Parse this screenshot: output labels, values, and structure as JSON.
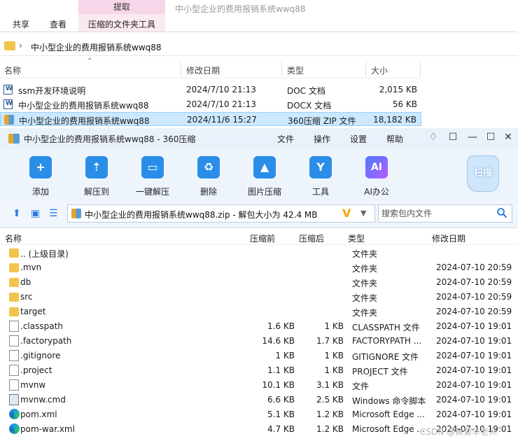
{
  "explorer": {
    "ribbon_tabs": [
      "共享",
      "查看"
    ],
    "context_tab_head": "提取",
    "context_tab": "压缩的文件夹工具",
    "ghost_title": "中小型企业的费用报销系统wwq88",
    "address": "中小型企业的费用报销系统wwq88",
    "columns": [
      "名称",
      "修改日期",
      "类型",
      "大小"
    ],
    "rows": [
      {
        "name": "ssm开发环境说明",
        "date": "2024/7/10 21:13",
        "type": "DOC 文档",
        "size": "2,015 KB",
        "icon": "word-icon"
      },
      {
        "name": "中小型企业的费用报销系统wwq88",
        "date": "2024/7/10 21:13",
        "type": "DOCX 文档",
        "size": "56 KB",
        "icon": "word-icon"
      },
      {
        "name": "中小型企业的费用报销系统wwq88",
        "date": "2024/11/6 15:27",
        "type": "360压缩 ZIP 文件",
        "size": "18,182 KB",
        "icon": "zip-icon",
        "selected": true
      }
    ]
  },
  "zipwin": {
    "title": "中小型企业的费用报销系统wwq88 - 360压缩",
    "menu": [
      "文件",
      "操作",
      "设置",
      "帮助"
    ],
    "tools": [
      {
        "label": "添加",
        "glyph": "+"
      },
      {
        "label": "解压到",
        "glyph": "⇡"
      },
      {
        "label": "一键解压",
        "glyph": "▭"
      },
      {
        "label": "删除",
        "glyph": "♻"
      },
      {
        "label": "图片压缩",
        "glyph": "▲"
      },
      {
        "label": "工具",
        "glyph": "Y"
      },
      {
        "label": "AI办公",
        "glyph": "AI"
      }
    ],
    "scan_label": "扫描",
    "path": "中小型企业的费用报销系统wwq88.zip - 解包大小为 42.4 MB",
    "search_placeholder": "搜索包内文件",
    "columns": [
      "名称",
      "压缩前",
      "压缩后",
      "类型",
      "修改日期"
    ],
    "rows": [
      {
        "name": ".. (上级目录)",
        "before": "",
        "after": "",
        "type": "文件夹",
        "date": "",
        "icon": "folder"
      },
      {
        "name": ".mvn",
        "before": "",
        "after": "",
        "type": "文件夹",
        "date": "2024-07-10 20:59",
        "icon": "folder"
      },
      {
        "name": "db",
        "before": "",
        "after": "",
        "type": "文件夹",
        "date": "2024-07-10 20:59",
        "icon": "folder"
      },
      {
        "name": "src",
        "before": "",
        "after": "",
        "type": "文件夹",
        "date": "2024-07-10 20:59",
        "icon": "folder"
      },
      {
        "name": "target",
        "before": "",
        "after": "",
        "type": "文件夹",
        "date": "2024-07-10 20:59",
        "icon": "folder"
      },
      {
        "name": ".classpath",
        "before": "1.6 KB",
        "after": "1 KB",
        "type": "CLASSPATH 文件",
        "date": "2024-07-10 19:01",
        "icon": "file"
      },
      {
        "name": ".factorypath",
        "before": "14.6 KB",
        "after": "1.7 KB",
        "type": "FACTORYPATH ...",
        "date": "2024-07-10 19:01",
        "icon": "file"
      },
      {
        "name": ".gitignore",
        "before": "1 KB",
        "after": "1 KB",
        "type": "GITIGNORE 文件",
        "date": "2024-07-10 19:01",
        "icon": "file"
      },
      {
        "name": ".project",
        "before": "1.1 KB",
        "after": "1 KB",
        "type": "PROJECT 文件",
        "date": "2024-07-10 19:01",
        "icon": "file"
      },
      {
        "name": "mvnw",
        "before": "10.1 KB",
        "after": "3.1 KB",
        "type": "文件",
        "date": "2024-07-10 19:01",
        "icon": "file"
      },
      {
        "name": "mvnw.cmd",
        "before": "6.6 KB",
        "after": "2.5 KB",
        "type": "Windows 命令脚本",
        "date": "2024-07-10 19:01",
        "icon": "cmd"
      },
      {
        "name": "pom.xml",
        "before": "5.1 KB",
        "after": "1.2 KB",
        "type": "Microsoft Edge ...",
        "date": "2024-07-10 19:01",
        "icon": "edge"
      },
      {
        "name": "pom-war.xml",
        "before": "4.7 KB",
        "after": "1.2 KB",
        "type": "Microsoft Edge ...",
        "date": "2024-07-10 19:01",
        "icon": "edge"
      }
    ]
  },
  "watermark": "CSDN @黄菊华老师"
}
